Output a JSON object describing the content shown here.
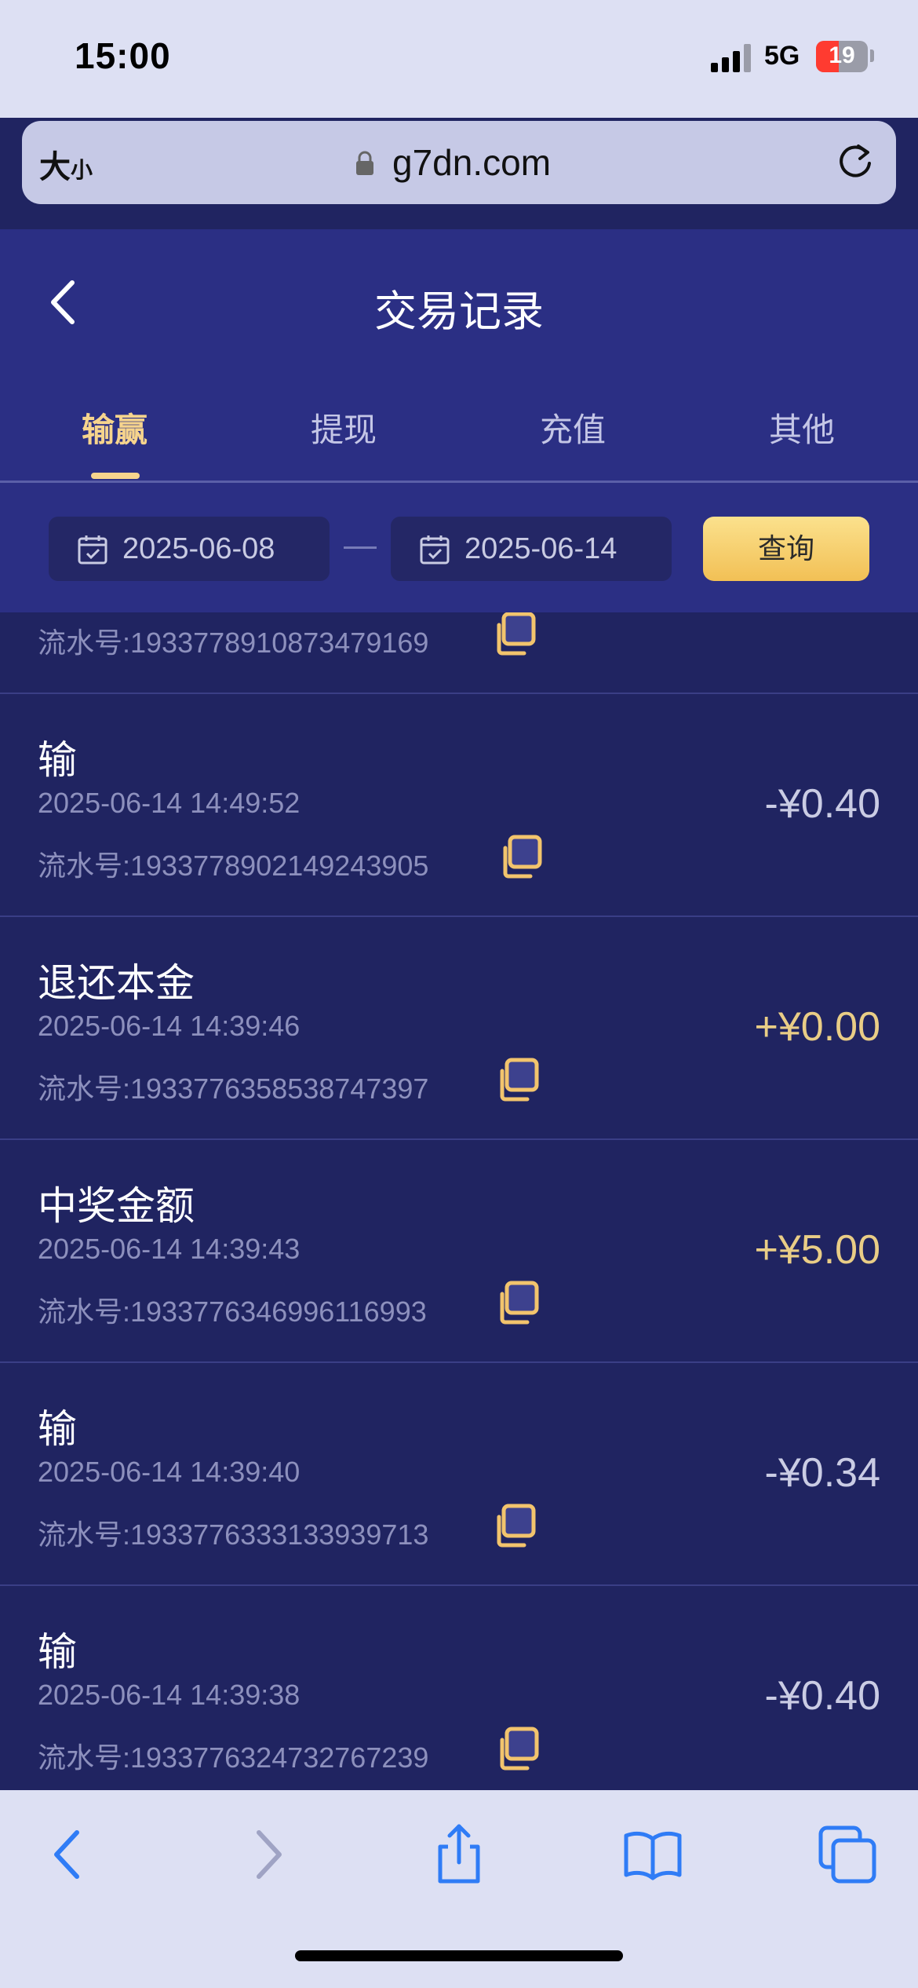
{
  "status_bar": {
    "time": "15:00",
    "network": "5G",
    "battery": "19"
  },
  "browser": {
    "size_label_big": "大",
    "size_label_small": "小",
    "url": "g7dn.com"
  },
  "header": {
    "title": "交易记录"
  },
  "tabs": [
    {
      "label": "输赢",
      "active": true
    },
    {
      "label": "提现",
      "active": false
    },
    {
      "label": "充值",
      "active": false
    },
    {
      "label": "其他",
      "active": false
    }
  ],
  "filter": {
    "start_date": "2025-06-08",
    "end_date": "2025-06-14",
    "query_label": "查询"
  },
  "partial_row": {
    "serial": "流水号:1933778910873479169"
  },
  "transactions": [
    {
      "title": "输",
      "time": "2025-06-14 14:49:52",
      "serial": "流水号:1933778902149243905",
      "amount": "-¥0.40",
      "sign": "neg"
    },
    {
      "title": "退还本金",
      "time": "2025-06-14 14:39:46",
      "serial": "流水号:1933776358538747397",
      "amount": "+¥0.00",
      "sign": "pos"
    },
    {
      "title": "中奖金额",
      "time": "2025-06-14 14:39:43",
      "serial": "流水号:1933776346996116993",
      "amount": "+¥5.00",
      "sign": "pos"
    },
    {
      "title": "输",
      "time": "2025-06-14 14:39:40",
      "serial": "流水号:1933776333133939713",
      "amount": "-¥0.34",
      "sign": "neg"
    },
    {
      "title": "输",
      "time": "2025-06-14 14:39:38",
      "serial": "流水号:1933776324732767239",
      "amount": "-¥0.40",
      "sign": "neg"
    }
  ],
  "colors": {
    "accent": "#f6d48d",
    "positive": "#e9cd86",
    "background": "#202461",
    "header": "#2b2f84",
    "toolbar_icon": "#2f7cf6"
  },
  "toolbar_icons": [
    "back-arrow-icon",
    "forward-arrow-icon",
    "share-icon",
    "bookmarks-icon",
    "tabs-icon"
  ]
}
